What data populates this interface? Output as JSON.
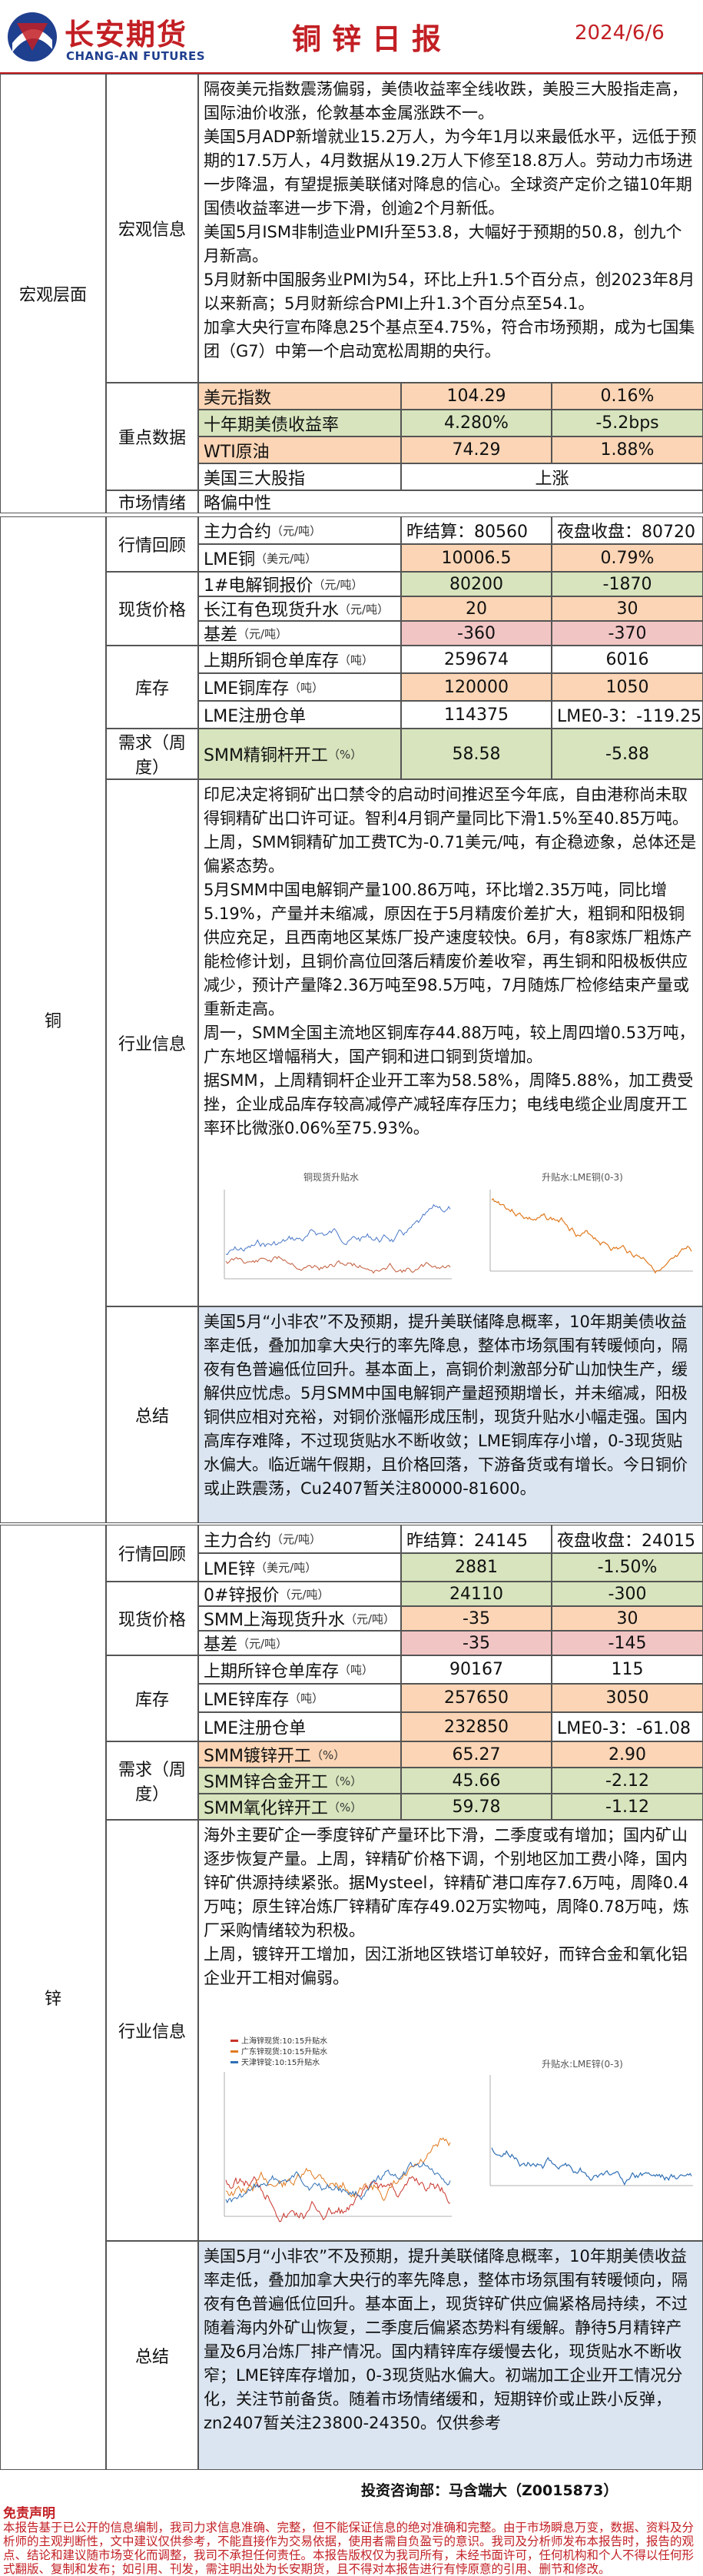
{
  "header": {
    "logo_cn": "长安期货",
    "logo_en": "CHANG-AN FUTURES",
    "title": "铜锌日报",
    "date": "2024/6/6"
  },
  "colors": {
    "brand_red": "#c21f24",
    "brand_blue": "#1f3f8f",
    "highlight_orange": "#fbd5b5",
    "highlight_green": "#d7e4bd",
    "summary_blue": "#dbe5f1"
  },
  "macro": {
    "section_label": "宏观层面",
    "info_label": "宏观信息",
    "info_paragraphs": [
      "隔夜美元指数震荡偏弱，美债收益率全线收跌，美股三大股指走高，国际油价收涨，伦敦基本金属涨跌不一。",
      "美国5月ADP新增就业15.2万人，为今年1月以来最低水平，远低于预期的17.5万人，4月数据从19.2万人下修至18.8万人。劳动力市场进一步降温，有望提振美联储对降息的信心。全球资产定价之锚10年期国债收益率进一步下滑，创逾2个月新低。",
      "美国5月ISM非制造业PMI升至53.8，大幅好于预期的50.8，创九个月新高。",
      "5月财新中国服务业PMI为54，环比上升1.5个百分点，创2023年8月以来新高；5月财新综合PMI上升1.3个百分点至54.1。",
      "加拿大央行宣布降息25个基点至4.75%，符合市场预期，成为七国集团（G7）中第一个启动宽松周期的央行。"
    ],
    "key_label": "重点数据",
    "key_rows": [
      {
        "name": "美元指数",
        "v1": "104.29",
        "v2": "0.16%"
      },
      {
        "name": "十年期美债收益率",
        "v1": "4.280%",
        "v2": "-5.2bps"
      },
      {
        "name": "WTI原油",
        "v1": "74.29",
        "v2": "1.88%"
      },
      {
        "name": "美国三大股指",
        "merged": "上涨"
      }
    ],
    "sentiment_label": "市场情绪",
    "sentiment_value": "略偏中性"
  },
  "copper": {
    "section_label": "铜",
    "quote_label": "行情回顾",
    "quote_rows": [
      {
        "name": "主力合约",
        "unit": "（元/吨）",
        "v1": "昨结算：80560",
        "v2": "夜盘收盘：80720"
      },
      {
        "name": "LME铜",
        "unit": "（美元/吨）",
        "v1": "10006.5",
        "v2": "0.79%"
      }
    ],
    "spot_label": "现货价格",
    "spot_rows": [
      {
        "name": "1#电解铜报价",
        "unit": "（元/吨）",
        "v1": "80200",
        "v2": "-1870"
      },
      {
        "name": "长江有色现货升水",
        "unit": "（元/吨）",
        "v1": "20",
        "v2": "30"
      },
      {
        "name": "基差",
        "unit": "（元/吨）",
        "v1": "-360",
        "v2": "-370"
      }
    ],
    "stock_label": "库存",
    "stock_rows": [
      {
        "name": "上期所铜仓单库存",
        "unit": "（吨）",
        "v1": "259674",
        "v2": "6016"
      },
      {
        "name": "LME铜库存",
        "unit": "（吨）",
        "v1": "120000",
        "v2": "1050"
      },
      {
        "name": "LME注册仓单",
        "unit": "",
        "v1": "114375",
        "v2": "LME0-3：-119.25"
      }
    ],
    "demand_label": "需求（周度）",
    "demand_rows": [
      {
        "name": "SMM精铜杆开工",
        "unit": "（%）",
        "v1": "58.58",
        "v2": "-5.88"
      }
    ],
    "industry_label": "行业信息",
    "industry_paragraphs": [
      "印尼决定将铜矿出口禁令的启动时间推迟至今年底，自由港称尚未取得铜精矿出口许可证。智利4月铜产量同比下滑1.5%至40.85万吨。上周，SMM铜精矿加工费TC为-0.71美元/吨，有企稳迹象，总体还是偏紧态势。",
      "5月SMM中国电解铜产量100.86万吨，环比增2.35万吨，同比增5.19%，产量并未缩减，原因在于5月精废价差扩大，粗铜和阳极铜供应充足，且西南地区某炼厂投产速度较快。6月，有8家炼厂粗炼产能检修计划，且铜价高位回落后精废价差收窄，再生铜和阳极板供应减少，预计产量降2.36万吨至98.5万吨，7月随炼厂检修结束产量或重新走高。",
      "周一，SMM全国主流地区铜库存44.88万吨，较上周四增0.53万吨，广东地区增幅稍大，国产铜和进口铜到货增加。",
      "据SMM，上周精铜杆企业开工率为58.58%，周降5.88%，加工费受挫，企业成品库存较高减停产减轻库存压力；电线电缆企业周度开工率环比微涨0.06%至75.93%。"
    ],
    "chart1_title": "铜现货升贴水",
    "chart2_title": "升贴水:LME铜(0-3)",
    "summary_label": "总结",
    "summary_text": "美国5月“小非农”不及预期，提升美联储降息概率，10年期美债收益率走低，叠加加拿大央行的率先降息，整体市场氛围有转暖倾向，隔夜有色普遍低位回升。基本面上，高铜价刺激部分矿山加快生产，缓解供应忧虑。5月SMM中国电解铜产量超预期增长，并未缩减，阳极铜供应相对充裕，对铜价涨幅形成压制，现货升贴水小幅走强。国内高库存难降，不过现货贴水不断收敛；LME铜库存小增，0-3现货贴水偏大。临近端午假期，且价格回落，下游备货或有增长。今日铜价或止跌震荡，Cu2407暂关注80000-81600。"
  },
  "zinc": {
    "section_label": "锌",
    "quote_label": "行情回顾",
    "quote_rows": [
      {
        "name": "主力合约",
        "unit": "（元/吨）",
        "v1": "昨结算：24145",
        "v2": "夜盘收盘：24015"
      },
      {
        "name": "LME锌",
        "unit": "（美元/吨）",
        "v1": "2881",
        "v2": "-1.50%"
      }
    ],
    "spot_label": "现货价格",
    "spot_rows": [
      {
        "name": "0#锌报价",
        "unit": "（元/吨）",
        "v1": "24110",
        "v2": "-300"
      },
      {
        "name": "SMM上海现货升水",
        "unit": "（元/吨）",
        "v1": "-35",
        "v2": "30"
      },
      {
        "name": "基差",
        "unit": "（元/吨）",
        "v1": "-35",
        "v2": "-145"
      }
    ],
    "stock_label": "库存",
    "stock_rows": [
      {
        "name": "上期所锌仓单库存",
        "unit": "（吨）",
        "v1": "90167",
        "v2": "115"
      },
      {
        "name": "LME锌库存",
        "unit": "（吨）",
        "v1": "257650",
        "v2": "3050"
      },
      {
        "name": "LME注册仓单",
        "unit": "",
        "v1": "232850",
        "v2": "LME0-3：-61.08"
      }
    ],
    "demand_label": "需求（周度）",
    "demand_rows": [
      {
        "name": "SMM镀锌开工",
        "unit": "（%）",
        "v1": "65.27",
        "v2": "2.90"
      },
      {
        "name": "SMM锌合金开工",
        "unit": "（%）",
        "v1": "45.66",
        "v2": "-2.12"
      },
      {
        "name": "SMM氧化锌开工",
        "unit": "（%）",
        "v1": "59.78",
        "v2": "-1.12"
      }
    ],
    "industry_label": "行业信息",
    "industry_paragraphs": [
      "海外主要矿企一季度锌矿产量环比下滑，二季度或有增加；国内矿山逐步恢复产量。上周，锌精矿价格下调，个别地区加工费小降，国内锌矿供源持续紧张。据Mysteel，锌精矿港口库存7.6万吨，周降0.4万吨；原生锌冶炼厂锌精矿库存49.02万实物吨，周降0.78万吨，炼厂采购情绪较为积极。",
      "上周，镀锌开工增加，因江浙地区铁塔订单较好，而锌合金和氧化铝企业开工相对偏弱。"
    ],
    "chart1_legend": [
      "上海锌现货:10:15升贴水",
      "广东锌现货:10:15升贴水",
      "天津锌锭:10:15升贴水"
    ],
    "chart2_title": "升贴水:LME锌(0-3)",
    "summary_label": "总结",
    "summary_text": "美国5月“小非农”不及预期，提升美联储降息概率，10年期美债收益率走低，叠加加拿大央行的率先降息，整体市场氛围有转暖倾向，隔夜有色普遍低位回升。基本面上，现货锌矿供应偏紧格局持续，不过随着海内外矿山恢复，二季度后偏紧态势料有缓解。静待5月精锌产量及6月冶炼厂排产情况。国内精锌库存缓慢去化，现货贴水不断收窄；LME锌库存增加，0-3现货贴水偏大。初端加工企业开工情况分化，关注节前备货。随着市场情绪缓和，短期锌价或止跌小反弹，zn2407暂关注23800-24350。仅供参考"
  },
  "footer": {
    "contact": "投资咨询部：马含端大（Z0015873）",
    "disclaimer_title": "免责声明",
    "disclaimer_text": "本报告基于已公开的信息编制，我司力求信息准确、完整，但不能保证信息的绝对准确和完整。由于市场瞬息万变，数据、资料及分析师的主观判断性，文中建议仅供参考，不能直接作为交易依据，使用者需自负盈亏的意识。我司及分析师发布本报告时，报告的观点、结论和建议随市场变化而调整，我司不承担任何责任。本报告版权仅为我司所有，未经书面许可，任何机构和个人不得以任何形式翻版、复制和发布；如引用、刊发，需注明出处为长安期货，且不得对本报告进行有悖原意的引用、删节和修改。"
  }
}
